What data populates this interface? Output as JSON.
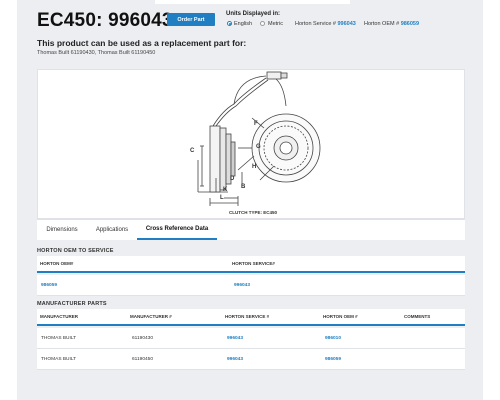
{
  "header": {
    "title": "EC450: 996043",
    "order_button": "Order Part",
    "units_label": "Units Displayed in:",
    "units": [
      {
        "label": "English",
        "selected": true
      },
      {
        "label": "Metric",
        "selected": false
      }
    ],
    "horton_service_label": "Horton Service #",
    "horton_service_value": "996043",
    "horton_oem_label": "Horton OEM #",
    "horton_oem_value": "986059"
  },
  "intro": {
    "subtitle": "This product can be used as a replacement part for:",
    "parts": "Thomas Built 61190430, Thomas Built 61190450"
  },
  "diagram": {
    "caption": "CLUTCH TYPE: EC450",
    "dimension_labels": [
      "C",
      "D",
      "K",
      "B",
      "L",
      "F",
      "G",
      "H"
    ]
  },
  "tabs": [
    {
      "label": "Dimensions",
      "active": false
    },
    {
      "label": "Applications",
      "active": false
    },
    {
      "label": "Cross Reference Data",
      "active": true
    }
  ],
  "oem_to_service": {
    "heading": "HORTON OEM TO SERVICE",
    "columns": [
      "HORTON OEM#",
      "HORTON SERVICE#"
    ],
    "rows": [
      {
        "oem": "986059",
        "service": "996043"
      }
    ]
  },
  "manufacturer_parts": {
    "heading": "MANUFACTURER PARTS",
    "columns": [
      "MANUFACTURER",
      "MANUFACTURER #",
      "HORTON SERVICE #",
      "HORTON OEM #",
      "COMMENTS"
    ],
    "rows": [
      {
        "manufacturer": "THOMAS BUILT",
        "mfr_number": "61190430",
        "service": "996043",
        "oem": "986010",
        "comments": ""
      },
      {
        "manufacturer": "THOMAS BUILT",
        "mfr_number": "61190450",
        "service": "996043",
        "oem": "986059",
        "comments": ""
      }
    ]
  },
  "colors": {
    "accent": "#1f7fc2",
    "page_bg": "#eceef1"
  }
}
